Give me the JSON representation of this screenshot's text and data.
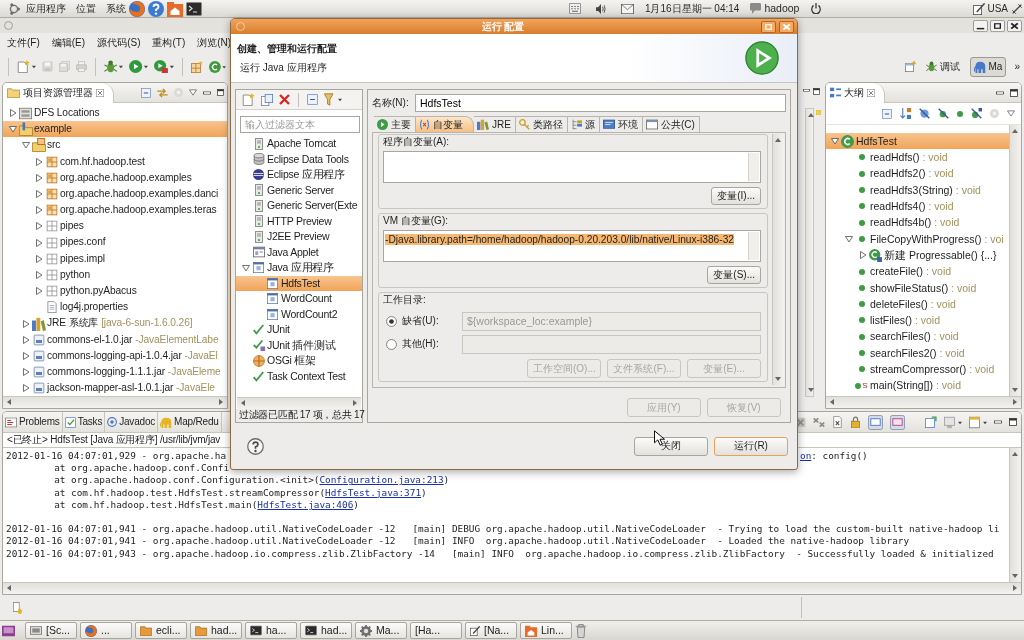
{
  "top_panel": {
    "menus": [
      "应用程序",
      "位置",
      "系统"
    ],
    "clock": "1月16日星期一 04:14",
    "user": "hadoop",
    "keyboard_layout": "USA"
  },
  "eclipse": {
    "menus": [
      "文件(F)",
      "编辑(E)",
      "源代码(S)",
      "重构(T)",
      "浏览(N)"
    ],
    "perspectives": [
      {
        "label": "调试",
        "kind": "debug",
        "selected": false
      },
      {
        "label": "Ma",
        "kind": "mapreduce",
        "selected": true
      }
    ],
    "perspective_overflow": "»",
    "project_explorer": {
      "title": "项目资源管理器",
      "items": [
        {
          "label": "DFS Locations",
          "kind": "dfs",
          "expanded": false,
          "selected": false
        },
        {
          "label": "example",
          "kind": "project",
          "expanded": true,
          "selected": true,
          "children": [
            {
              "label": "src",
              "kind": "source-folder",
              "expanded": true,
              "selected": false,
              "children": [
                {
                  "label": "com.hf.hadoop.test",
                  "kind": "package",
                  "expanded": false,
                  "selected": false
                },
                {
                  "label": "org.apache.hadoop.examples",
                  "kind": "package",
                  "expanded": false,
                  "selected": false
                },
                {
                  "label": "org.apache.hadoop.examples.danci",
                  "kind": "package",
                  "expanded": false,
                  "selected": false
                },
                {
                  "label": "org.apache.hadoop.examples.teras",
                  "kind": "package",
                  "expanded": false,
                  "selected": false
                },
                {
                  "label": "pipes",
                  "kind": "empty-package",
                  "expanded": false,
                  "selected": false
                },
                {
                  "label": "pipes.conf",
                  "kind": "empty-package",
                  "expanded": false,
                  "selected": false
                },
                {
                  "label": "pipes.impl",
                  "kind": "empty-package",
                  "expanded": false,
                  "selected": false
                },
                {
                  "label": "python",
                  "kind": "empty-package",
                  "expanded": false,
                  "selected": false
                },
                {
                  "label": "python.pyAbacus",
                  "kind": "empty-package",
                  "expanded": false,
                  "selected": false
                },
                {
                  "label": "log4j.properties",
                  "kind": "file",
                  "selected": false
                }
              ]
            },
            {
              "label": "JRE 系统库",
              "decoration": "[java-6-sun-1.6.0.26]",
              "kind": "library",
              "expanded": false,
              "selected": false
            },
            {
              "label": "commons-el-1.0.jar",
              "decoration": "-JavaElementLabe",
              "kind": "jar",
              "expanded": false,
              "selected": false
            },
            {
              "label": "commons-logging-api-1.0.4.jar",
              "decoration": "-JavaEl",
              "kind": "jar",
              "expanded": false,
              "selected": false
            },
            {
              "label": "commons-logging-1.1.1.jar",
              "decoration": "-JavaEleme",
              "kind": "jar",
              "expanded": false,
              "selected": false
            },
            {
              "label": "jackson-mapper-asl-1.0.1.jar",
              "decoration": "-JavaEle",
              "kind": "jar",
              "expanded": false,
              "selected": false
            }
          ]
        }
      ]
    },
    "outline": {
      "title": "大纲",
      "items": [
        {
          "label": "HdfsTest",
          "kind": "class",
          "expanded": true,
          "selected": true,
          "children": [
            {
              "label": "readHdfs()",
              "type": ": void",
              "kind": "method",
              "selected": false
            },
            {
              "label": "readHdfs2()",
              "type": ": void",
              "kind": "method",
              "selected": false
            },
            {
              "label": "readHdfs3(String)",
              "type": ": void",
              "kind": "method",
              "selected": false
            },
            {
              "label": "readHdfs4()",
              "type": ": void",
              "kind": "method",
              "selected": false
            },
            {
              "label": "readHdfs4b()",
              "type": ": void",
              "kind": "method",
              "selected": false
            },
            {
              "label": "FileCopyWithProgress()",
              "type": ": voi",
              "kind": "method",
              "expanded": true,
              "selected": false,
              "children": [
                {
                  "label": "新建 Progressable() {...}",
                  "kind": "anonymous-class",
                  "expanded": false,
                  "selected": false
                }
              ]
            },
            {
              "label": "createFile()",
              "type": ": void",
              "kind": "method",
              "selected": false
            },
            {
              "label": "showFileStatus()",
              "type": ": void",
              "kind": "method",
              "selected": false
            },
            {
              "label": "deleteFiles()",
              "type": ": void",
              "kind": "method",
              "selected": false
            },
            {
              "label": "listFiles()",
              "type": ": void",
              "kind": "method",
              "selected": false
            },
            {
              "label": "searchFiles()",
              "type": ": void",
              "kind": "method",
              "selected": false
            },
            {
              "label": "searchFiles2()",
              "type": ": void",
              "kind": "method",
              "selected": false
            },
            {
              "label": "streamCompressor()",
              "type": ": void",
              "kind": "method",
              "selected": false
            },
            {
              "label": "main(String[])",
              "type": ": void",
              "kind": "method",
              "overlay": "S",
              "selected": false
            }
          ]
        }
      ]
    },
    "bottom_tabs": [
      {
        "label": "Problems",
        "kind": "problems",
        "selected": false
      },
      {
        "label": "Tasks",
        "kind": "tasks",
        "selected": false
      },
      {
        "label": "Javadoc",
        "kind": "javadoc",
        "selected": false
      },
      {
        "label": "Map/Redu",
        "kind": "mapreduce",
        "selected": false
      }
    ],
    "console": {
      "header": "<已终止> HdfsTest [Java 应用程序] /usr/lib/jvm/jav",
      "entries": [
        {
          "lines": [
            {
              "indented": false,
              "parts": [
                {
                  "kind": "text",
                  "text": "2012-01-16 04:07:01,929 - org.apache.ha"
                }
              ],
              "tail": [
                {
                  "kind": "link",
                  "text": "on"
                },
                {
                  "kind": "text",
                  "text": ": config()"
                }
              ]
            },
            {
              "indented": true,
              "parts": [
                {
                  "kind": "text",
                  "text": "at org.apache.hadoop.conf.Confi"
                }
              ]
            },
            {
              "indented": true,
              "parts": [
                {
                  "kind": "text",
                  "text": "at org.apache.hadoop.conf.Configuration.<init>("
                },
                {
                  "kind": "link",
                  "text": "Configuration.java:213"
                },
                {
                  "kind": "text",
                  "text": ")"
                }
              ]
            },
            {
              "indented": true,
              "parts": [
                {
                  "kind": "text",
                  "text": "at com.hf.hadoop.test.HdfsTest.streamCompressor("
                },
                {
                  "kind": "link",
                  "text": "HdfsTest.java:371"
                },
                {
                  "kind": "text",
                  "text": ")"
                }
              ]
            },
            {
              "indented": true,
              "parts": [
                {
                  "kind": "text",
                  "text": "at com.hf.hadoop.test.HdfsTest.main("
                },
                {
                  "kind": "link",
                  "text": "HdfsTest.java:406"
                },
                {
                  "kind": "text",
                  "text": ")"
                }
              ]
            }
          ]
        },
        {
          "lines": [
            {
              "indented": false,
              "parts": [
                {
                  "kind": "text",
                  "text": "2012-01-16 04:07:01,941 - org.apache.hadoop.util.NativeCodeLoader -12   [main] DEBUG org.apache.hadoop.util.NativeCodeLoader  - Trying to load the custom-built native-hadoop li"
                }
              ]
            },
            {
              "indented": false,
              "parts": [
                {
                  "kind": "text",
                  "text": "2012-01-16 04:07:01,941 - org.apache.hadoop.util.NativeCodeLoader -12   [main] INFO  org.apache.hadoop.util.NativeCodeLoader  - Loaded the native-hadoop library"
                }
              ]
            },
            {
              "indented": false,
              "parts": [
                {
                  "kind": "text",
                  "text": "2012-01-16 04:07:01,943 - org.apache.hadoop.io.compress.zlib.ZlibFactory -14   [main] INFO  org.apache.hadoop.io.compress.zlib.ZlibFactory  - Successfully loaded & initialized"
                }
              ]
            }
          ]
        }
      ]
    }
  },
  "dialog": {
    "title": "运行 配置",
    "heading": "创建、管理和运行配置",
    "subheading": "运行 Java 应用程序",
    "filter": {
      "placeholder": "输入过滤器文本"
    },
    "configs": [
      {
        "label": "Apache Tomcat",
        "kind": "server",
        "selected": false
      },
      {
        "label": "Eclipse Data Tools",
        "kind": "database",
        "selected": false
      },
      {
        "label": "Eclipse 应用程序",
        "kind": "eclipse",
        "selected": false
      },
      {
        "label": "Generic Server",
        "kind": "server",
        "selected": false
      },
      {
        "label": "Generic Server(Exte",
        "kind": "server",
        "selected": false
      },
      {
        "label": "HTTP Preview",
        "kind": "server",
        "selected": false
      },
      {
        "label": "J2EE Preview",
        "kind": "server",
        "selected": false
      },
      {
        "label": "Java Applet",
        "kind": "applet",
        "selected": false
      },
      {
        "label": "Java 应用程序",
        "kind": "java-app",
        "expanded": true,
        "selected": false,
        "children": [
          {
            "label": "HdfsTest",
            "kind": "java-app",
            "selected": true
          },
          {
            "label": "WordCount",
            "kind": "java-app",
            "selected": false
          },
          {
            "label": "WordCount2",
            "kind": "java-app",
            "selected": false
          }
        ]
      },
      {
        "label": "JUnit",
        "kind": "junit",
        "selected": false
      },
      {
        "label": "JUnit 插件测试",
        "kind": "junit-plugin",
        "selected": false
      },
      {
        "label": "OSGi 框架",
        "kind": "osgi",
        "selected": false
      },
      {
        "label": "Task Context Test",
        "kind": "junit",
        "selected": false
      }
    ],
    "match_status": "过滤器已匹配 17 项，总共 17",
    "name_label": "名称(N):",
    "name_value": "HdfsTest",
    "tabs": [
      {
        "label": "主要",
        "kind": "main",
        "selected": false
      },
      {
        "label": "自变量",
        "kind": "arguments",
        "selected": true
      },
      {
        "label": "JRE",
        "kind": "jre",
        "selected": false
      },
      {
        "label": "类路径",
        "kind": "classpath",
        "selected": false
      },
      {
        "label": "源",
        "kind": "source",
        "selected": false
      },
      {
        "label": "环境",
        "kind": "environment",
        "selected": false
      },
      {
        "label": "公共(C)",
        "kind": "common",
        "selected": false
      }
    ],
    "program_args": {
      "label": "程序自变量(A):",
      "button": "变量(I)..."
    },
    "vm_args": {
      "label": "VM 自变量(G):",
      "value": "-Djava.library.path=/home/hadoop/hadoop-0.20.203.0/lib/native/Linux-i386-32",
      "text_selected": true,
      "button": "变量(S)..."
    },
    "working_dir": {
      "label": "工作目录:",
      "options": [
        {
          "label": "缺省(U):",
          "selected": true,
          "value": "${workspace_loc:example}",
          "field_disabled": true
        },
        {
          "label": "其他(H):",
          "selected": false,
          "field_disabled": true
        }
      ],
      "buttons": [
        {
          "label": "工作空间(O)...",
          "disabled": true
        },
        {
          "label": "文件系统(F)...",
          "disabled": true
        },
        {
          "label": "变量(E)...",
          "disabled": true
        }
      ]
    },
    "actions": [
      {
        "label": "应用(Y)",
        "disabled": true
      },
      {
        "label": "恢复(V)",
        "disabled": true
      }
    ],
    "buttons": [
      {
        "label": "关闭",
        "default": false
      },
      {
        "label": "运行(R)",
        "default": true
      }
    ]
  },
  "taskbar": [
    {
      "label": "[Sc...",
      "kind": "screenshot"
    },
    {
      "label": "...",
      "kind": "browser"
    },
    {
      "label": "ecli...",
      "kind": "folder"
    },
    {
      "label": "had...",
      "kind": "folder"
    },
    {
      "label": "ha...",
      "kind": "terminal"
    },
    {
      "label": "had...",
      "kind": "terminal"
    },
    {
      "label": "Ma...",
      "kind": "settings"
    },
    {
      "label": "[Ha...",
      "kind": "blank"
    },
    {
      "label": "[Na...",
      "kind": "editor"
    },
    {
      "label": "Lin...",
      "kind": "home"
    }
  ]
}
